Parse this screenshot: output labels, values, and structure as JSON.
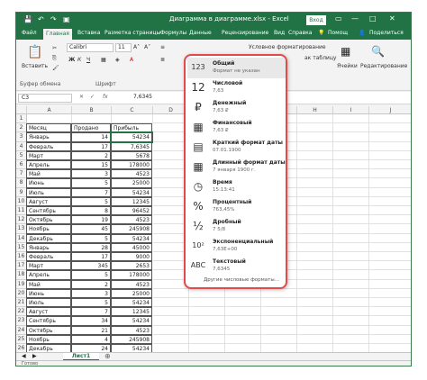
{
  "window": {
    "title": "Диаграмма в диаграмме.xlsx  -  Excel",
    "login_button": "Вход",
    "quick_access": [
      "save-icon",
      "undo-icon",
      "redo-icon",
      "camera-icon"
    ],
    "window_buttons": [
      "ribbon-display-icon",
      "minimize-icon",
      "maximize-icon",
      "close-icon"
    ]
  },
  "tabs": [
    {
      "label": "Файл"
    },
    {
      "label": "Главная"
    },
    {
      "label": "Вставка"
    },
    {
      "label": "Разметка страницы"
    },
    {
      "label": "Формулы"
    },
    {
      "label": "Данные"
    },
    {
      "label": "Рецензирование"
    },
    {
      "label": "Вид"
    },
    {
      "label": "Справка"
    },
    {
      "label": "Помощ"
    }
  ],
  "active_tab": "Главная",
  "share_label": "Поделиться",
  "ribbon": {
    "paste_label": "Вставить",
    "clipboard_group": "Буфер обмена",
    "font_name": "Calibri",
    "font_size": "11",
    "bold": "Ж",
    "italic": "К",
    "underline": "Ч",
    "font_group": "Шрифт",
    "conditional_format": "Условное форматирование",
    "as_table": "ак таблицу",
    "cells_label": "Ячейки",
    "editing_label": "Редактирование"
  },
  "formula_bar": {
    "name_box": "C3",
    "fx": "fx",
    "value": "7,6345"
  },
  "columns": [
    "A",
    "B",
    "C",
    "D",
    "E",
    "F",
    "G",
    "H",
    "I",
    "J"
  ],
  "rows": [
    {
      "n": "1",
      "a": "",
      "b": "",
      "c": ""
    },
    {
      "n": "2",
      "a": "Месяц",
      "b": "Продано",
      "c": "Прибыль"
    },
    {
      "n": "3",
      "a": "Январь",
      "b": "14",
      "c": "54234"
    },
    {
      "n": "4",
      "a": "Февраль",
      "b": "17",
      "c": "7,6345"
    },
    {
      "n": "5",
      "a": "Март",
      "b": "2",
      "c": "5678"
    },
    {
      "n": "6",
      "a": "Апрель",
      "b": "15",
      "c": "178000"
    },
    {
      "n": "7",
      "a": "Май",
      "b": "3",
      "c": "4523"
    },
    {
      "n": "8",
      "a": "Июнь",
      "b": "5",
      "c": "25000"
    },
    {
      "n": "9",
      "a": "Июль",
      "b": "7",
      "c": "54234"
    },
    {
      "n": "10",
      "a": "Август",
      "b": "5",
      "c": "12345"
    },
    {
      "n": "11",
      "a": "Сентябрь",
      "b": "8",
      "c": "96452"
    },
    {
      "n": "12",
      "a": "Октябрь",
      "b": "19",
      "c": "4523"
    },
    {
      "n": "13",
      "a": "Ноябрь",
      "b": "45",
      "c": "245908"
    },
    {
      "n": "14",
      "a": "Декабрь",
      "b": "5",
      "c": "54234"
    },
    {
      "n": "15",
      "a": "Январь",
      "b": "28",
      "c": "45000"
    },
    {
      "n": "16",
      "a": "Февраль",
      "b": "17",
      "c": "9000"
    },
    {
      "n": "17",
      "a": "Март",
      "b": "345",
      "c": "2653"
    },
    {
      "n": "18",
      "a": "Апрель",
      "b": "5",
      "c": "178000"
    },
    {
      "n": "19",
      "a": "Май",
      "b": "2",
      "c": "4523"
    },
    {
      "n": "20",
      "a": "Июнь",
      "b": "3",
      "c": "25000"
    },
    {
      "n": "21",
      "a": "Июль",
      "b": "5",
      "c": "54234"
    },
    {
      "n": "22",
      "a": "Август",
      "b": "7",
      "c": "12345"
    },
    {
      "n": "23",
      "a": "Сентябрь",
      "b": "34",
      "c": "54234"
    },
    {
      "n": "24",
      "a": "Октябрь",
      "b": "21",
      "c": "4523"
    },
    {
      "n": "25",
      "a": "Ноябрь",
      "b": "4",
      "c": "245908"
    },
    {
      "n": "26",
      "a": "Декабрь",
      "b": "24",
      "c": "54234"
    }
  ],
  "number_formats": [
    {
      "icon": "123",
      "icon_name": "general-format-icon",
      "name": "Общий",
      "sample": "Формат не указан"
    },
    {
      "icon": "12",
      "icon_name": "number-format-icon",
      "name": "Числовой",
      "sample": "7,63"
    },
    {
      "icon": "₽",
      "icon_name": "currency-format-icon",
      "name": "Денежный",
      "sample": "7,63 ₽"
    },
    {
      "icon": "▦",
      "icon_name": "accounting-format-icon",
      "name": "Финансовый",
      "sample": "7,63 ₽"
    },
    {
      "icon": "▤",
      "icon_name": "short-date-icon",
      "name": "Краткий формат даты",
      "sample": "07.01.1900"
    },
    {
      "icon": "▦",
      "icon_name": "long-date-icon",
      "name": "Длинный формат даты",
      "sample": "7 января 1900 г."
    },
    {
      "icon": "◷",
      "icon_name": "time-format-icon",
      "name": "Время",
      "sample": "15:13:41"
    },
    {
      "icon": "%",
      "icon_name": "percent-format-icon",
      "name": "Процентный",
      "sample": "763,45%"
    },
    {
      "icon": "½",
      "icon_name": "fraction-format-icon",
      "name": "Дробный",
      "sample": "7 5/8"
    },
    {
      "icon": "10²",
      "icon_name": "scientific-format-icon",
      "name": "Экспоненциальный",
      "sample": "7,63E+00"
    },
    {
      "icon": "ABC",
      "icon_name": "text-format-icon",
      "name": "Текстовый",
      "sample": "7,6345"
    }
  ],
  "more_formats": "Другие числовые форматы...",
  "sheet_tab": "Лист1",
  "status_left": "Готово",
  "accent_color": "#217346",
  "highlight_color": "#e34a4a"
}
